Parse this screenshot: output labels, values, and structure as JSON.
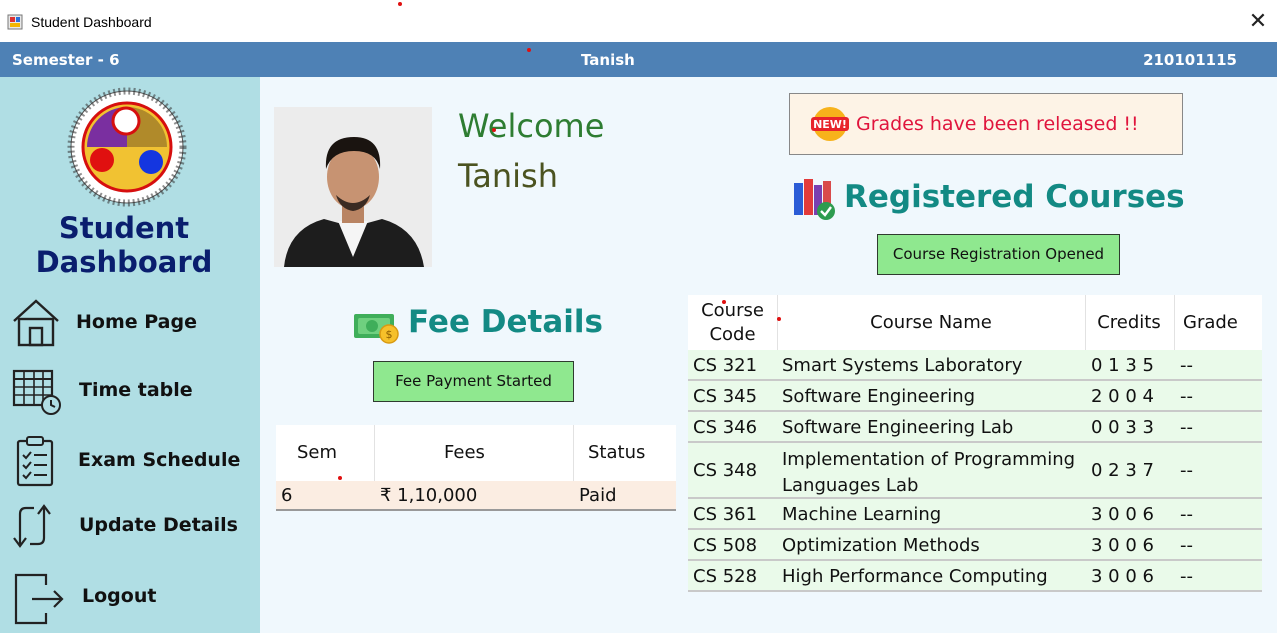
{
  "window": {
    "title": "Student Dashboard",
    "close_glyph": "✕"
  },
  "header": {
    "semester": "Semester - 6",
    "name": "Tanish",
    "roll": "210101115"
  },
  "sidebar": {
    "title_line1": "Student",
    "title_line2": "Dashboard",
    "items": [
      {
        "label": "Home Page",
        "icon": "home-icon"
      },
      {
        "label": "Time table",
        "icon": "calendar-icon"
      },
      {
        "label": "Exam Schedule",
        "icon": "checklist-icon"
      },
      {
        "label": "Update Details",
        "icon": "update-arrows-icon"
      },
      {
        "label": "Logout",
        "icon": "logout-icon"
      }
    ]
  },
  "welcome": {
    "line1": "Welcome",
    "line2": "Tanish"
  },
  "fee": {
    "title": "Fee Details",
    "button": "Fee Payment Started",
    "headers": {
      "sem": "Sem",
      "fees": "Fees",
      "status": "Status"
    },
    "rows": [
      {
        "sem": "6",
        "fees": "₹ 1,10,000",
        "status": "Paid"
      }
    ]
  },
  "notice": {
    "badge": "NEW!",
    "text": "Grades have been released !!"
  },
  "courses": {
    "title": "Registered Courses",
    "button": "Course Registration Opened",
    "headers": {
      "code_line1": "Course",
      "code_line2": "Code",
      "name": "Course Name",
      "credits": "Credits",
      "grade": "Grade"
    },
    "rows": [
      {
        "code": "CS 321",
        "name": "Smart Systems Laboratory",
        "name2": "",
        "credits": "0 1 3 5",
        "grade": "--"
      },
      {
        "code": "CS 345",
        "name": "Software Engineering",
        "name2": "",
        "credits": "2 0 0 4",
        "grade": "--"
      },
      {
        "code": "CS 346",
        "name": "Software Engineering Lab",
        "name2": "",
        "credits": "0 0 3 3",
        "grade": "--"
      },
      {
        "code": "CS 348",
        "name": "Implementation of Programming",
        "name2": "Languages Lab",
        "credits": "0 2 3 7",
        "grade": "--"
      },
      {
        "code": "CS 361",
        "name": "Machine Learning",
        "name2": "",
        "credits": "3 0 0 6",
        "grade": "--"
      },
      {
        "code": "CS 508",
        "name": "Optimization Methods",
        "name2": "",
        "credits": "3 0 0 6",
        "grade": "--"
      },
      {
        "code": "CS 528",
        "name": "High Performance Computing",
        "name2": "",
        "credits": "3 0 0 6",
        "grade": "--"
      }
    ]
  },
  "colors": {
    "header_bar": "#4e81b5",
    "sidebar": "#b0dee4",
    "heading_teal": "#138a84",
    "button_green": "#8fe88f",
    "notice_red": "#e0143c",
    "sidebar_title": "#0a1e6e"
  }
}
